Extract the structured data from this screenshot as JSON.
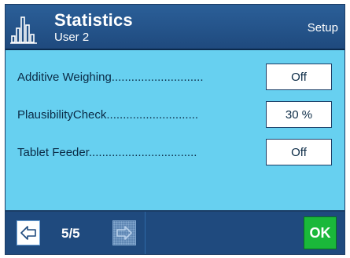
{
  "header": {
    "title": "Statistics",
    "subtitle": "User 2",
    "setup_label": "Setup",
    "icon": "statistics-bars-icon"
  },
  "settings": {
    "rows": [
      {
        "label": "Additive Weighing............................",
        "value": "Off"
      },
      {
        "label": "PlausibilityCheck............................",
        "value": "30 %"
      },
      {
        "label": "Tablet Feeder.................................",
        "value": "Off"
      }
    ]
  },
  "footer": {
    "back_icon": "arrow-left-icon",
    "next_icon": "arrow-right-icon",
    "page_indicator": "5/5",
    "ok_label": "OK"
  },
  "colors": {
    "background": "#67d0f0",
    "header": "#1f4a7e",
    "ok_button": "#1ab83a"
  }
}
